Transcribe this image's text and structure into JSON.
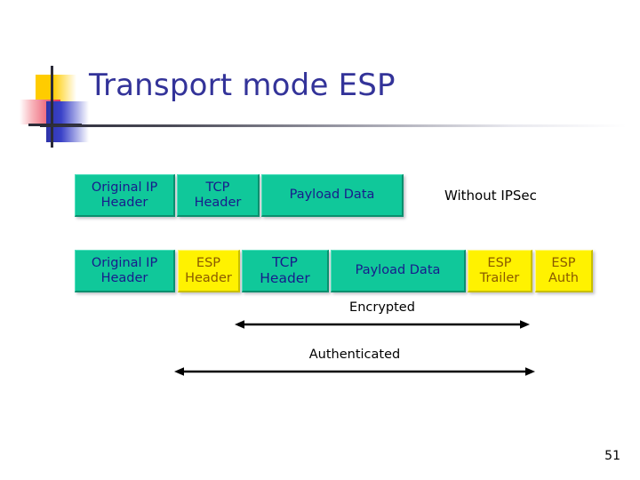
{
  "slide": {
    "title": "Transport mode ESP",
    "page_number": "51",
    "title_color": "#333399"
  },
  "logo": {
    "yellow": "#FFCC00",
    "red": "#E8405A",
    "blue": "#2E33A8",
    "cross": "#2B2B38"
  },
  "colors": {
    "teal_box": "#10C89A",
    "teal_text": "#181B8C",
    "yellow_box": "#FFF200",
    "yellow_text": "#8A5A00"
  },
  "diagram": {
    "rows": [
      {
        "name": "without-ipsec-packet",
        "note": "Without IPSec",
        "boxes": [
          {
            "line1": "Original IP",
            "line2": "Header",
            "type": "teal"
          },
          {
            "line1": "TCP",
            "line2": "Header",
            "type": "teal"
          },
          {
            "line1": "Payload Data",
            "line2": "",
            "type": "teal"
          }
        ]
      },
      {
        "name": "esp-transport-packet",
        "note": "",
        "boxes": [
          {
            "line1": "Original IP",
            "line2": "Header",
            "type": "teal"
          },
          {
            "line1": "ESP",
            "line2": "Header",
            "type": "yellow"
          },
          {
            "line1": "TCP",
            "line2": "Header",
            "type": "teal"
          },
          {
            "line1": "Payload Data",
            "line2": "",
            "type": "teal"
          },
          {
            "line1": "ESP",
            "line2": "Trailer",
            "type": "yellow"
          },
          {
            "line1": "ESP",
            "line2": "Auth",
            "type": "yellow"
          }
        ]
      }
    ],
    "spans": [
      {
        "name": "encrypted-span",
        "label": "Encrypted"
      },
      {
        "name": "authenticated-span",
        "label": "Authenticated"
      }
    ]
  }
}
